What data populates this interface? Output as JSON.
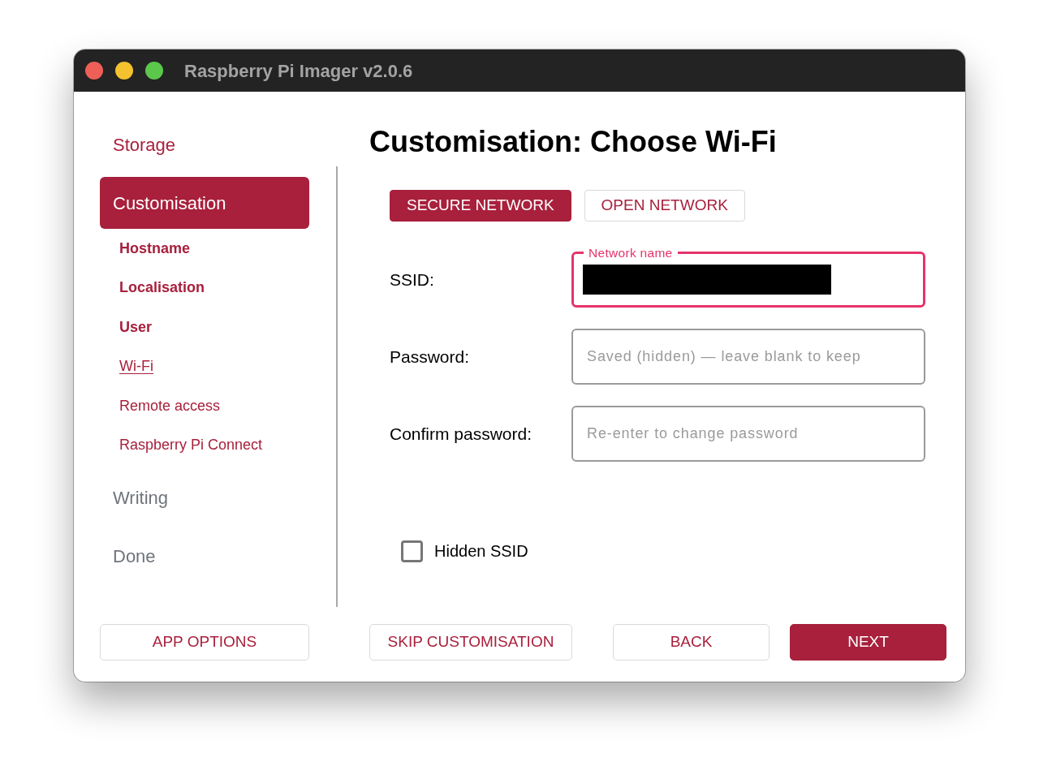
{
  "window": {
    "title": "Raspberry Pi Imager v2.0.6"
  },
  "sidebar": {
    "steps": [
      {
        "label": "Storage",
        "selected": false,
        "disabled": false
      },
      {
        "label": "Customisation",
        "selected": true,
        "disabled": false,
        "children": [
          {
            "label": "Hostname",
            "selected": false,
            "done": true
          },
          {
            "label": "Localisation",
            "selected": false,
            "done": true
          },
          {
            "label": "User",
            "selected": false,
            "done": true
          },
          {
            "label": "Wi-Fi",
            "selected": true,
            "done": false
          },
          {
            "label": "Remote access",
            "selected": false,
            "done": false
          },
          {
            "label": "Raspberry Pi Connect",
            "selected": false,
            "done": false
          }
        ]
      },
      {
        "label": "Writing",
        "selected": false,
        "disabled": true
      },
      {
        "label": "Done",
        "selected": false,
        "disabled": true
      }
    ],
    "button": "APP OPTIONS"
  },
  "heading": "Customisation: Choose Wi-Fi",
  "tabs": [
    {
      "label": "SECURE NETWORK",
      "selected": true
    },
    {
      "label": "OPEN NETWORK",
      "selected": false
    }
  ],
  "fields": [
    {
      "label": "SSID:",
      "floating_label": "Network name",
      "focused": true,
      "redacted": true
    },
    {
      "label": "Password:",
      "placeholder": "Saved (hidden) — leave blank to keep",
      "focused": false,
      "redacted": false
    },
    {
      "label": "Confirm password:",
      "placeholder": "Re-enter to change password",
      "focused": false,
      "redacted": false
    }
  ],
  "hidden_ssid": {
    "label": "Hidden SSID",
    "checked": false
  },
  "footer_buttons": [
    {
      "label": "SKIP CUSTOMISATION",
      "kind": "outline"
    },
    {
      "label": "BACK",
      "kind": "outline"
    },
    {
      "label": "NEXT",
      "kind": "filled"
    }
  ]
}
